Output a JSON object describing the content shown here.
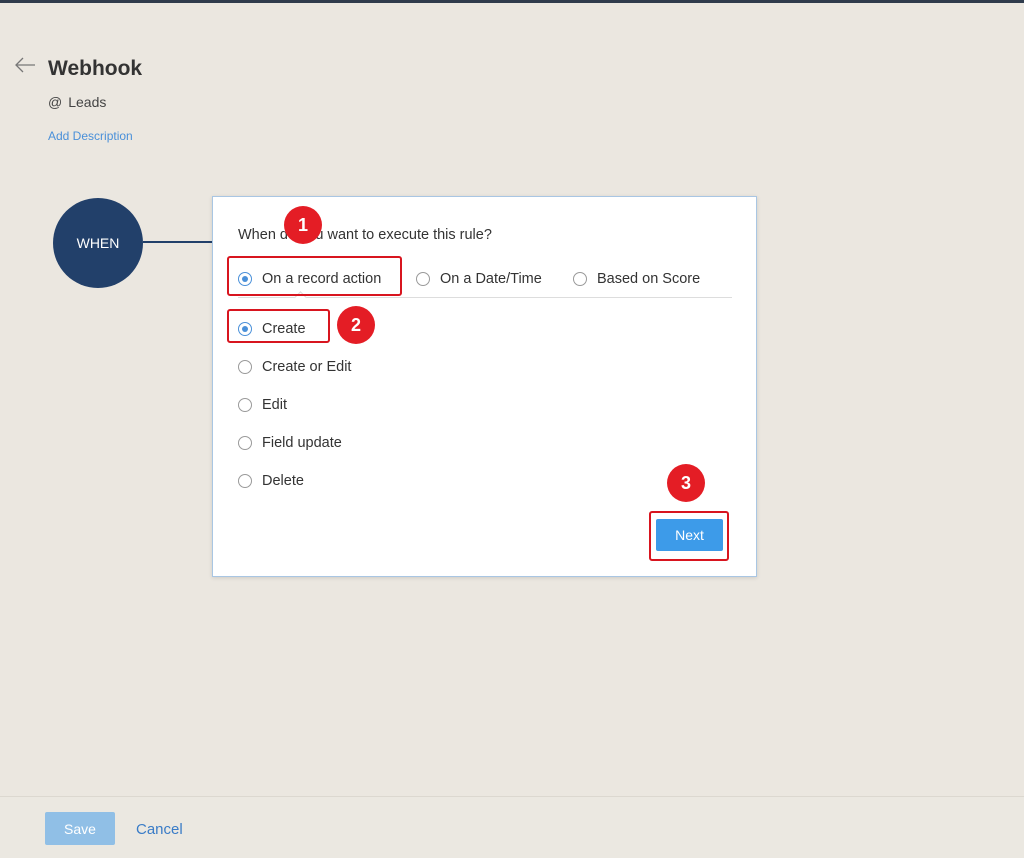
{
  "header": {
    "title": "Webhook",
    "module_prefix": "@",
    "module": "Leads",
    "add_description": "Add Description"
  },
  "flow": {
    "when_label": "WHEN"
  },
  "rule_card": {
    "question": "When do you want to execute this rule?",
    "trigger_options": [
      "On a record action",
      "On a Date/Time",
      "Based on Score"
    ],
    "selected_trigger": "On a record action",
    "action_options": [
      "Create",
      "Create or Edit",
      "Edit",
      "Field update",
      "Delete"
    ],
    "selected_action": "Create",
    "next_label": "Next"
  },
  "annotations": {
    "badges": [
      "1",
      "2",
      "3"
    ],
    "highlight_color": "#d8151f",
    "badge_color": "#e41d25"
  },
  "footer": {
    "save_label": "Save",
    "cancel_label": "Cancel"
  },
  "colors": {
    "accent": "#3d9be9",
    "when_circle": "#22406a",
    "link": "#4a90d9"
  }
}
